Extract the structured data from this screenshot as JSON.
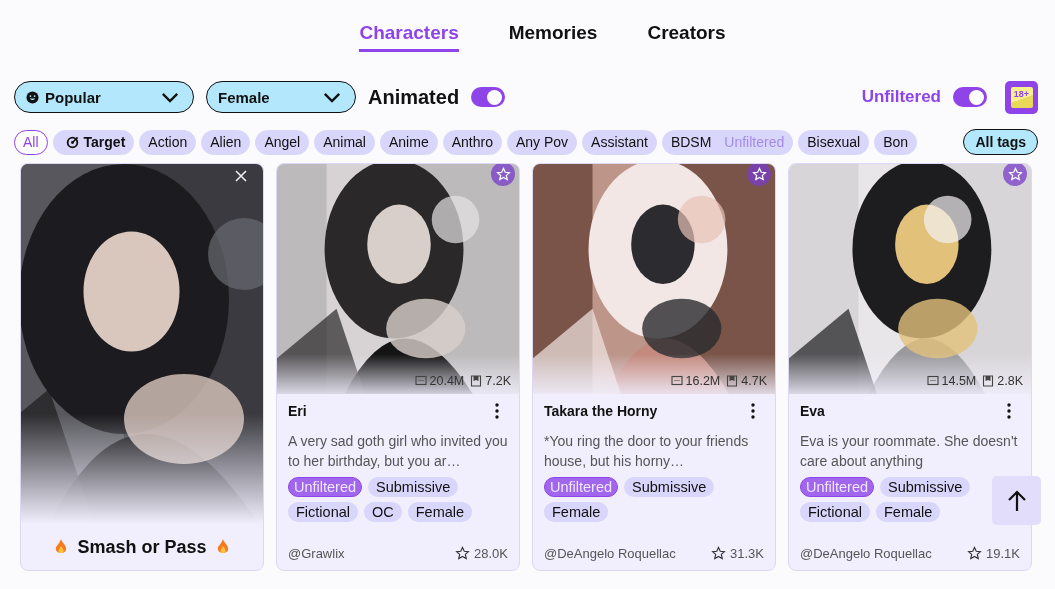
{
  "tabs": [
    {
      "label": "Characters",
      "selected": true
    },
    {
      "label": "Memories",
      "selected": false
    },
    {
      "label": "Creators",
      "selected": false
    }
  ],
  "filters": {
    "sort": {
      "label": "Popular"
    },
    "gender": {
      "label": "Female"
    },
    "animated": {
      "label": "Animated",
      "on": true
    },
    "unfiltered": {
      "label": "Unfiltered",
      "on": true
    },
    "adult_badge": "18+"
  },
  "tags": [
    {
      "label": "All",
      "selected": true,
      "kind": "plain"
    },
    {
      "label": "Target",
      "selected": false,
      "kind": "target"
    },
    {
      "label": "Action",
      "selected": false,
      "kind": "plain"
    },
    {
      "label": "Alien",
      "selected": false,
      "kind": "plain"
    },
    {
      "label": "Angel",
      "selected": false,
      "kind": "plain"
    },
    {
      "label": "Animal",
      "selected": false,
      "kind": "plain"
    },
    {
      "label": "Anime",
      "selected": false,
      "kind": "plain"
    },
    {
      "label": "Anthro",
      "selected": false,
      "kind": "plain"
    },
    {
      "label": "Any Pov",
      "selected": false,
      "kind": "plain"
    },
    {
      "label": "Assistant",
      "selected": false,
      "kind": "plain"
    },
    {
      "label": "BDSM",
      "selected": false,
      "kind": "plain",
      "note": "Unfiltered"
    },
    {
      "label": "Bisexual",
      "selected": false,
      "kind": "plain"
    },
    {
      "label": "Bon",
      "selected": false,
      "kind": "plain"
    }
  ],
  "all_tags_button": "All tags",
  "promo": {
    "title": "Smash or Pass"
  },
  "cards": [
    {
      "name": "Eri",
      "chats": "20.4M",
      "saves": "7.2K",
      "description": "A very sad goth girl who invited you to her birthday, but you ar…",
      "tags": [
        {
          "label": "Unfiltered",
          "kind": "unfiltered"
        },
        {
          "label": "Submissive",
          "kind": "plain"
        },
        {
          "label": "Fictional",
          "kind": "plain"
        },
        {
          "label": "OC",
          "kind": "plain"
        },
        {
          "label": "Female",
          "kind": "plain"
        }
      ],
      "author": "@Grawlix",
      "rating": "28.0K"
    },
    {
      "name": "Takara the Horny",
      "chats": "16.2M",
      "saves": "4.7K",
      "description": "*You ring the door to your friends house, but his horny…",
      "tags": [
        {
          "label": "Unfiltered",
          "kind": "unfiltered"
        },
        {
          "label": "Submissive",
          "kind": "plain"
        },
        {
          "label": "Female",
          "kind": "plain"
        }
      ],
      "author": "@DeAngelo Roquellac",
      "rating": "31.3K"
    },
    {
      "name": "Eva",
      "chats": "14.5M",
      "saves": "2.8K",
      "description": "Eva is your roommate. She doesn't care about anything",
      "tags": [
        {
          "label": "Unfiltered",
          "kind": "unfiltered"
        },
        {
          "label": "Submissive",
          "kind": "plain"
        },
        {
          "label": "Fictional",
          "kind": "plain"
        },
        {
          "label": "Female",
          "kind": "plain"
        }
      ],
      "author": "@DeAngelo Roquellac",
      "rating": "19.1K"
    }
  ]
}
